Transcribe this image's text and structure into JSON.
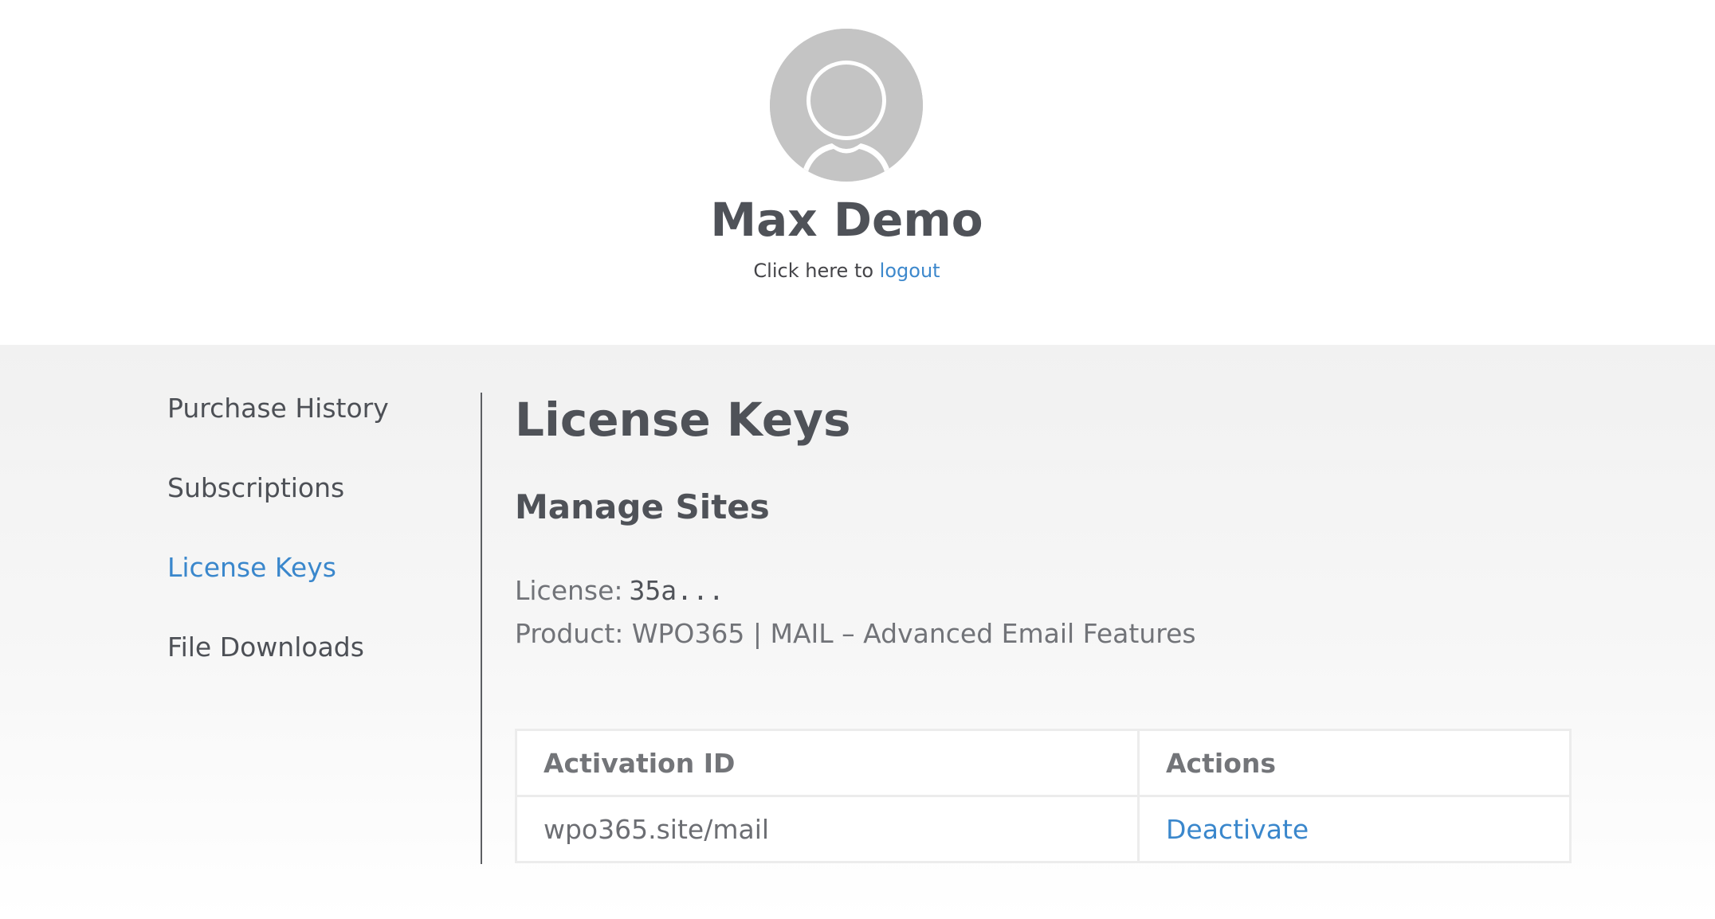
{
  "profile": {
    "name": "Max Demo",
    "logout_prefix": "Click here to ",
    "logout_link": "logout"
  },
  "sidebar": {
    "items": [
      {
        "label": "Purchase History",
        "active": false
      },
      {
        "label": "Subscriptions",
        "active": false
      },
      {
        "label": "License Keys",
        "active": true
      },
      {
        "label": "File Downloads",
        "active": false
      }
    ]
  },
  "main": {
    "title": "License Keys",
    "section_title": "Manage Sites",
    "license_label": "License:",
    "license_key": "35a...",
    "product_label": "Product: WPO365 | MAIL – Advanced Email Features",
    "table": {
      "headers": [
        "Activation ID",
        "Actions"
      ],
      "rows": [
        {
          "activation_id": "wpo365.site/mail",
          "action": "Deactivate"
        }
      ]
    }
  },
  "colors": {
    "accent": "#3a87cc",
    "text": "#4f5258",
    "avatar": "#c4c4c4",
    "band_background": "#f1f1f1"
  },
  "icons": {
    "avatar": "default-user-avatar-icon"
  }
}
